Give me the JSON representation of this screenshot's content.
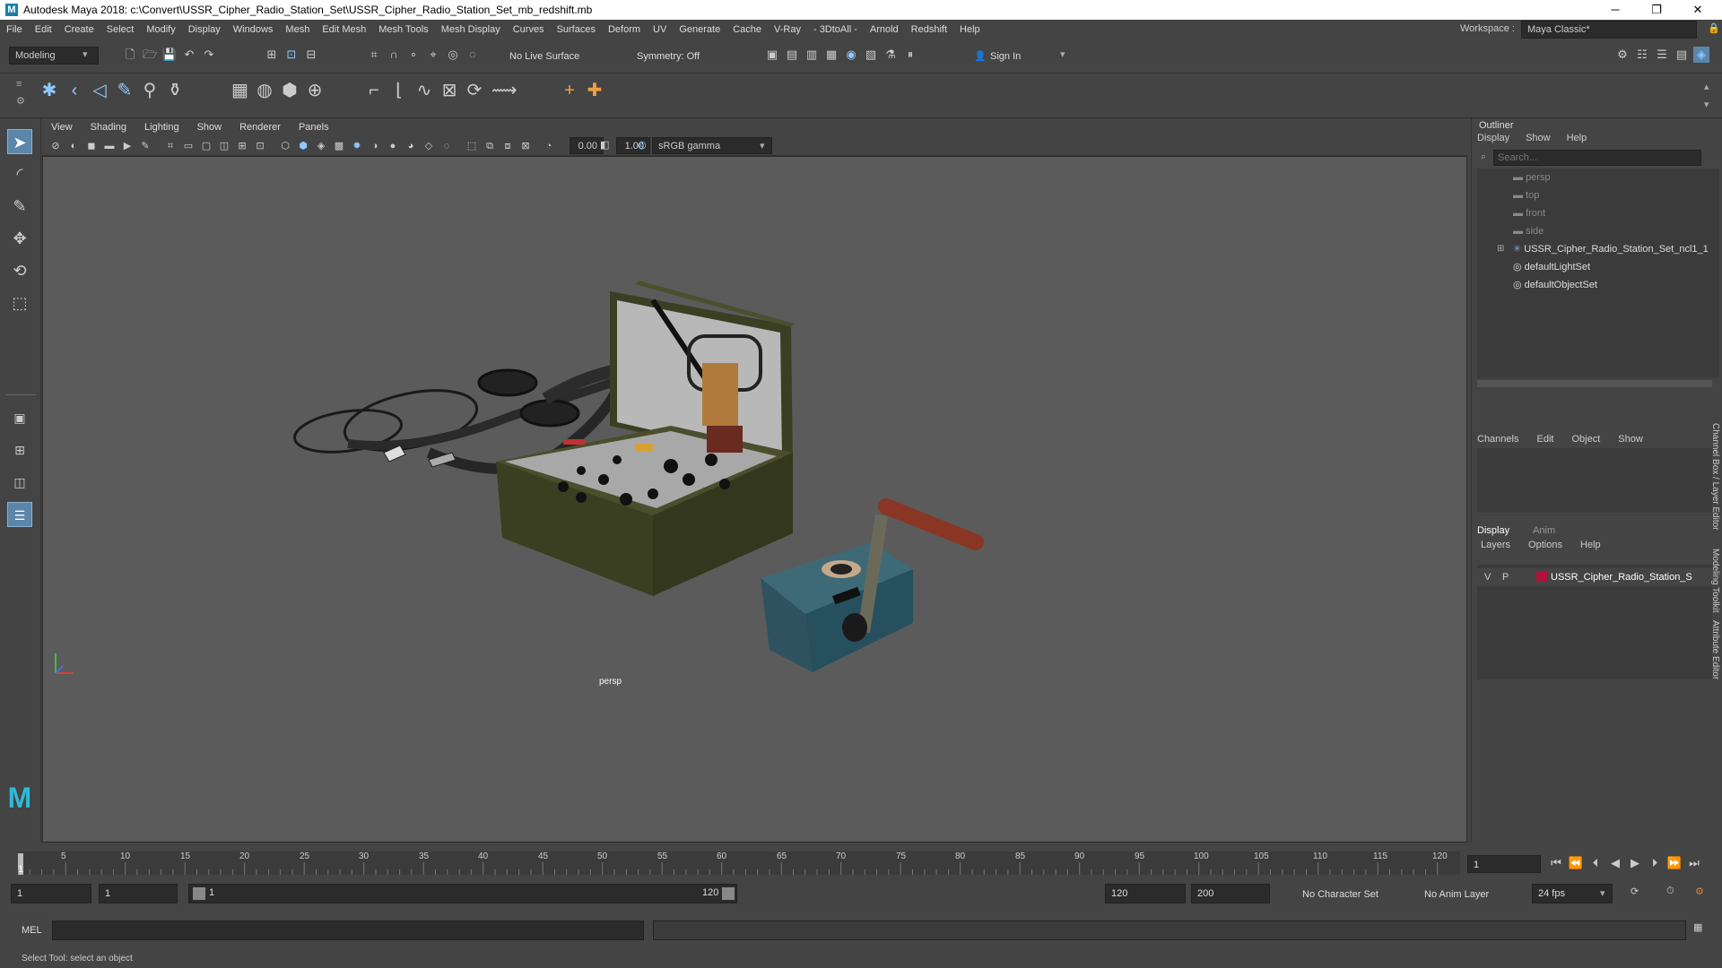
{
  "window": {
    "title": "Autodesk Maya 2018: c:\\Convert\\USSR_Cipher_Radio_Station_Set\\USSR_Cipher_Radio_Station_Set_mb_redshift.mb",
    "logo_letter": "M",
    "minimize": "─",
    "maximize": "❐",
    "close": "✕"
  },
  "menubar": {
    "items": [
      "File",
      "Edit",
      "Create",
      "Select",
      "Modify",
      "Display",
      "Windows",
      "Mesh",
      "Edit Mesh",
      "Mesh Tools",
      "Mesh Display",
      "Curves",
      "Surfaces",
      "Deform",
      "UV",
      "Generate",
      "Cache",
      "V-Ray",
      "- 3DtoAll -",
      "Arnold",
      "Redshift",
      "Help"
    ],
    "workspace_label": "Workspace :",
    "workspace_value": "Maya Classic*"
  },
  "statusline": {
    "mode": "Modeling",
    "live_surface": "No Live Surface",
    "symmetry": "Symmetry: Off",
    "sign_in": "Sign In"
  },
  "viewport": {
    "menu": [
      "View",
      "Shading",
      "Lighting",
      "Show",
      "Renderer",
      "Panels"
    ],
    "exposure": "0.00",
    "gamma": "1.00",
    "color_space": "sRGB gamma",
    "camera_label": "persp"
  },
  "outliner": {
    "title": "Outliner",
    "menu": [
      "Display",
      "Show",
      "Help"
    ],
    "search_placeholder": "Search...",
    "items": [
      {
        "label": "persp",
        "dim": true,
        "icon": "camera-icon"
      },
      {
        "label": "top",
        "dim": true,
        "icon": "camera-icon"
      },
      {
        "label": "front",
        "dim": true,
        "icon": "camera-icon"
      },
      {
        "label": "side",
        "dim": true,
        "icon": "camera-icon"
      },
      {
        "label": "USSR_Cipher_Radio_Station_Set_ncl1_1",
        "dim": false,
        "icon": "group-icon",
        "expander": "⊞"
      },
      {
        "label": "defaultLightSet",
        "dim": false,
        "icon": "set-icon"
      },
      {
        "label": "defaultObjectSet",
        "dim": false,
        "icon": "set-icon"
      }
    ]
  },
  "channelbox": {
    "menu": [
      "Channels",
      "Edit",
      "Object",
      "Show"
    ]
  },
  "layers": {
    "tabs": [
      "Display",
      "Anim"
    ],
    "menu": [
      "Layers",
      "Options",
      "Help"
    ],
    "row": {
      "v": "V",
      "p": "P",
      "name": "USSR_Cipher_Radio_Station_S",
      "color": "#b0103a"
    }
  },
  "side_tabs": [
    "Channel Box / Layer Editor",
    "Modeling Toolkit",
    "Attribute Editor"
  ],
  "timeline": {
    "ticks": [
      "5",
      "10",
      "15",
      "20",
      "25",
      "30",
      "35",
      "40",
      "45",
      "50",
      "55",
      "60",
      "65",
      "70",
      "75",
      "80",
      "85",
      "90",
      "95",
      "100",
      "105",
      "110",
      "115",
      "120"
    ],
    "current_frame": "1",
    "frame_field": "1"
  },
  "range": {
    "start": "1",
    "start2": "1",
    "slider_start": "1",
    "slider_end": "120",
    "end": "120",
    "end2": "200",
    "character_set": "No Character Set",
    "anim_layer": "No Anim Layer",
    "fps": "24 fps"
  },
  "command": {
    "label": "MEL",
    "help": "Select Tool: select an object"
  }
}
